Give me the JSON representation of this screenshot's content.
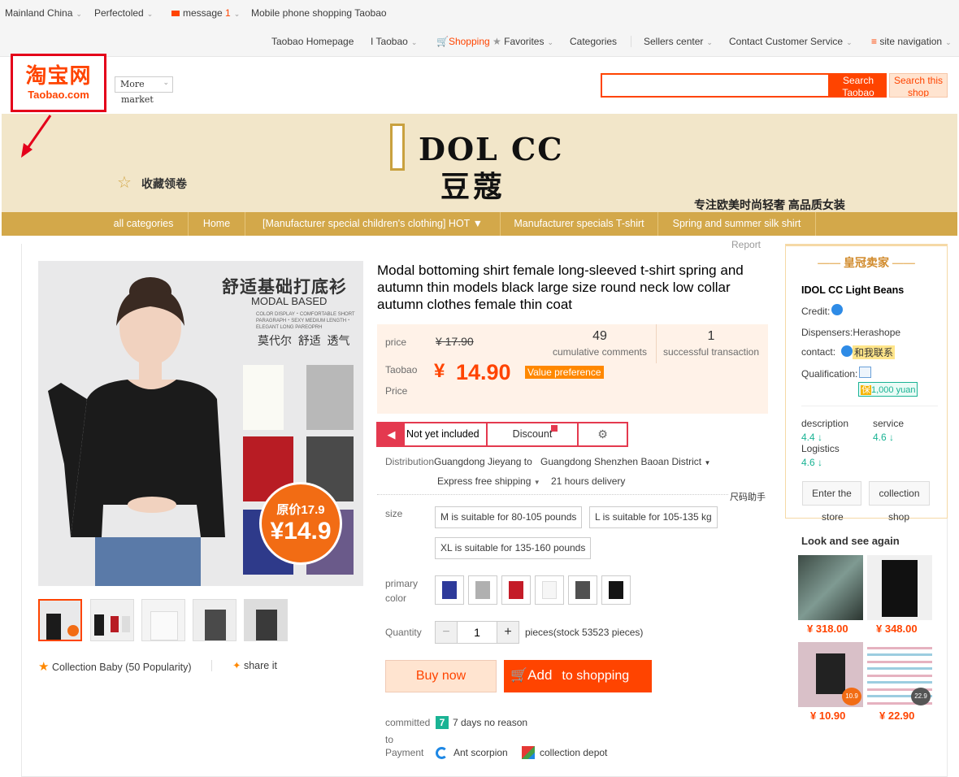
{
  "topbar": {
    "region": "Mainland China",
    "user": "Perfectoled",
    "message": "message",
    "message_count": "1",
    "mobile": "Mobile phone shopping Taobao",
    "links": [
      "Taobao Homepage",
      "I Taobao",
      "Shopping",
      "Favorites",
      "Categories",
      "Sellers center",
      "Contact Customer Service",
      "site navigation"
    ],
    "cart_overlay": "Cart"
  },
  "header": {
    "logo_cn": "淘宝网",
    "logo_en": "Taobao.com",
    "more_market_1": "More",
    "more_market_2": "market",
    "search_value": "",
    "search_taobao": "Search Taobao",
    "search_shop": "Search this shop"
  },
  "banner": {
    "brand": "I DOL CC",
    "brand_cn": "豆蔻",
    "collect": "收藏领卷",
    "slogan": "专注欧美时尚轻奢 高品质女装"
  },
  "nav": [
    "all categories",
    "Home",
    "[Manufacturer special children's clothing] HOT",
    "Manufacturer specials T-shirt",
    "Spring and summer silk shirt"
  ],
  "report": "Report",
  "product": {
    "image_title": "舒适基础打底衫",
    "image_sub": "MODAL BASED",
    "image_small": "COLOR DISPLAY・COMFORTABLE SHORT PARAGRAPH・SEXY MEDIUM LENGTH・ELEGANT LONG PAREOPRH",
    "image_tag": "莫代尔  舒适  透气",
    "badge_orig": "原价17.9",
    "badge_price": "¥14.9",
    "title": "Modal bottoming shirt female long-sleeved t-shirt spring and autumn thin models black large size round neck low collar autumn clothes female thin coat",
    "price_label": "price",
    "orig_price": "¥ 17.90",
    "tb_price_label_1": "Taobao",
    "tb_price_label_2": "Price",
    "currency": "¥",
    "price": "14.90",
    "value_pref": "Value preference",
    "comments_count": "49",
    "comments_label": "cumulative comments",
    "trans_count": "1",
    "trans_label": "successful transaction",
    "tab_not_included": "Not yet included",
    "tab_discount": "Discount",
    "distribution_label": "Distribution",
    "distribution_from": "Guangdong Jieyang to",
    "distribution_to": "Guangdong Shenzhen Baoan District",
    "shipping": "Express free shipping",
    "delivery": "21 hours delivery",
    "size_helper": "尺码助手",
    "size_label": "size",
    "sizes": [
      "M is suitable for 80-105 pounds",
      "L is suitable for 105-135 kg",
      "XL is suitable for 135-160 pounds"
    ],
    "color_label_1": "primary",
    "color_label_2": "color",
    "quantity_label": "Quantity",
    "quantity": "1",
    "stock": "pieces(stock 53523 pieces)",
    "buy_now": "Buy now",
    "add_1": "Add",
    "add_2": "to shopping",
    "committed_1": "committed",
    "committed_2": "to",
    "seven_days": "7 days no reason",
    "payment": "Payment",
    "ant": "Ant scorpion",
    "depot": "collection depot",
    "collection_baby": "Collection Baby (50 Popularity)",
    "share": "share it"
  },
  "shop": {
    "crown": "皇冠卖家",
    "name": "IDOL CC Light Beans",
    "credit": "Credit:",
    "dispensers": "Dispensers:Herashope",
    "contact": "contact:",
    "contact_btn": "和我联系",
    "qualification": "Qualification:",
    "deposit": "1,000 yuan",
    "description": "description",
    "desc_score": "4.4",
    "service": "service",
    "service_score": "4.6",
    "logistics": "Logistics",
    "logistics_score": "4.6",
    "enter_1": "Enter the",
    "enter_2": "store",
    "collect_1": "collection",
    "collect_2": "shop"
  },
  "recommend": {
    "title": "Look and see again",
    "prices": [
      "¥ 318.00",
      "¥ 348.00",
      "¥ 10.90",
      "¥ 22.90"
    ],
    "badges": [
      "10.9",
      "22.9"
    ]
  },
  "colors": {
    "accent": "#ff4400",
    "nav": "#d3a84a",
    "banner": "#f2e6c9",
    "logo_border": "#e4001a"
  }
}
